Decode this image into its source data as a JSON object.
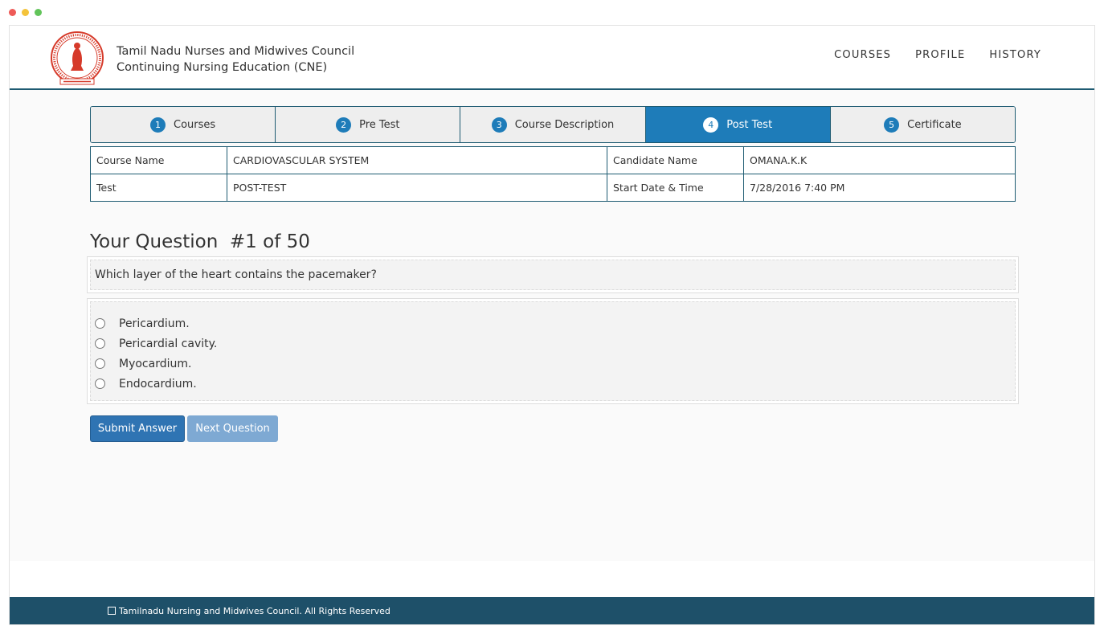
{
  "header": {
    "org_name": "Tamil Nadu Nurses and Midwives Council",
    "program": "Continuing Nursing Education (CNE)",
    "nav": [
      "COURSES",
      "PROFILE",
      "HISTORY"
    ],
    "accent": "#1e5b72"
  },
  "steps": [
    {
      "num": "1",
      "label": "Courses"
    },
    {
      "num": "2",
      "label": "Pre Test"
    },
    {
      "num": "3",
      "label": "Course Description"
    },
    {
      "num": "4",
      "label": "Post Test"
    },
    {
      "num": "5",
      "label": "Certificate"
    }
  ],
  "info": {
    "course_name_label": "Course Name",
    "course_name": "CARDIOVASCULAR SYSTEM",
    "candidate_label": "Candidate Name",
    "candidate": "OMANA.K.K",
    "test_label": "Test",
    "test": "POST-TEST",
    "start_label": "Start Date & Time",
    "start": "7/28/2016 7:40 PM"
  },
  "question": {
    "title": "Your Question  #1 of 50",
    "text": "Which layer of the heart contains the pacemaker?",
    "options": [
      "Pericardium.",
      "Pericardial cavity.",
      "Myocardium.",
      "Endocardium."
    ]
  },
  "buttons": {
    "submit": "Submit Answer",
    "next": "Next Question"
  },
  "footer": {
    "text": "Tamilnadu Nursing and Midwives Council. All Rights Reserved"
  }
}
